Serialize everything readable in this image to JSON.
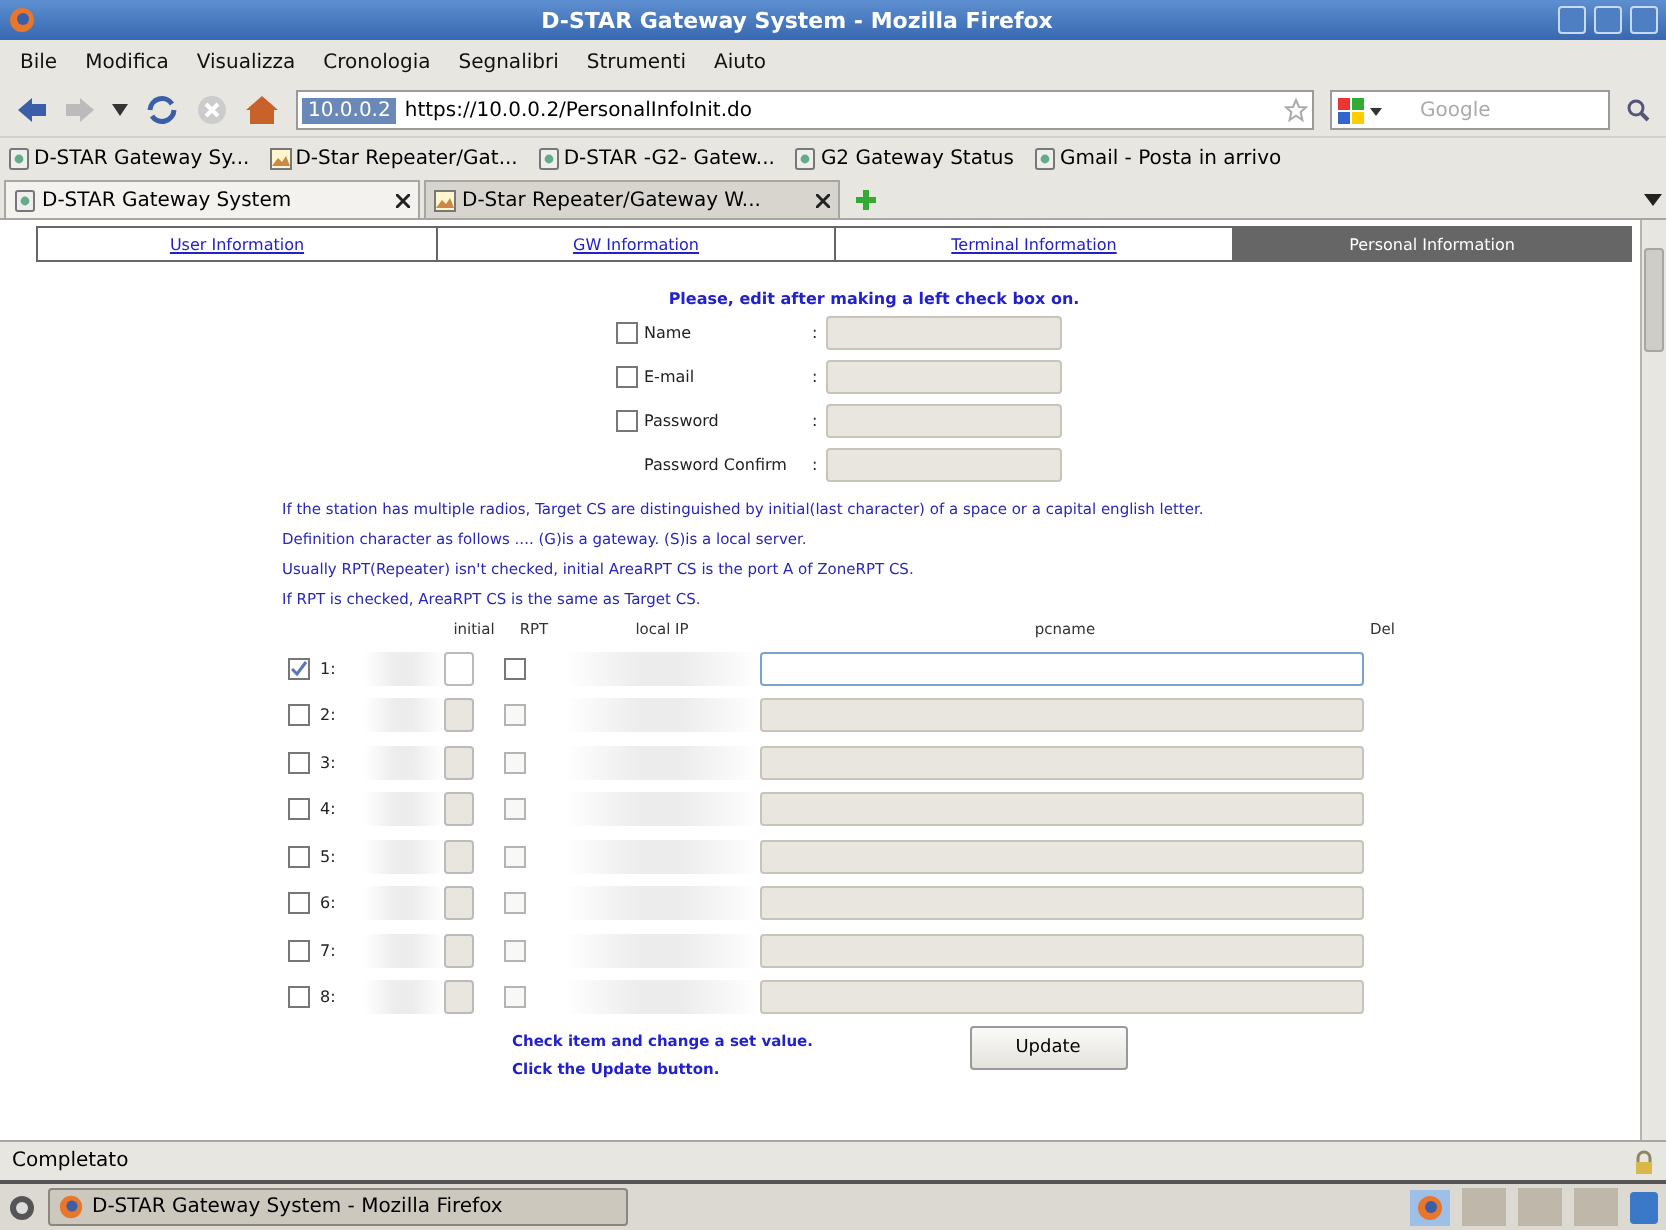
{
  "window": {
    "title": "D-STAR Gateway System - Mozilla Firefox"
  },
  "menu": [
    "Bile",
    "Modifica",
    "Visualizza",
    "Cronologia",
    "Segnalibri",
    "Strumenti",
    "Aiuto"
  ],
  "address_bar": {
    "site": "10.0.0.2",
    "url": "https://10.0.0.2/PersonalInfoInit.do"
  },
  "search": {
    "placeholder": "Google"
  },
  "bookmarks": [
    {
      "label": "D-STAR Gateway Sy...",
      "kind": "page"
    },
    {
      "label": "D-Star Repeater/Gat...",
      "kind": "image"
    },
    {
      "label": "D-STAR -G2- Gatew...",
      "kind": "page"
    },
    {
      "label": "G2 Gateway Status",
      "kind": "page"
    },
    {
      "label": "Gmail - Posta in arrivo",
      "kind": "page"
    }
  ],
  "tabs": [
    {
      "label": "D-STAR Gateway System",
      "selected": true,
      "kind": "page"
    },
    {
      "label": "D-Star Repeater/Gateway W...",
      "selected": false,
      "kind": "image"
    }
  ],
  "nav": [
    {
      "label": "User Information",
      "selected": false
    },
    {
      "label": "GW Information",
      "selected": false
    },
    {
      "label": "Terminal Information",
      "selected": false
    },
    {
      "label": "Personal Information",
      "selected": true
    }
  ],
  "form": {
    "heading": "Please, edit after making a left check box on.",
    "fields": [
      {
        "label": "Name",
        "separator": ":",
        "kind": "checkable",
        "checked": false
      },
      {
        "label": "E-mail",
        "separator": ":",
        "kind": "checkable",
        "checked": false
      },
      {
        "label": "Password",
        "separator": ":",
        "kind": "checkable",
        "checked": false
      },
      {
        "label": "Password Confirm",
        "separator": ":",
        "kind": "plain"
      }
    ]
  },
  "notes": [
    "If the station has multiple radios, Target CS are distinguished by initial(last character) of a space or a capital english letter.",
    "Definition character as follows .... (G)is a gateway. (S)is a local server.",
    "Usually RPT(Repeater) isn't checked, initial AreaRPT CS is the port A of ZoneRPT CS.",
    "If RPT is checked, AreaRPT CS is the same as Target CS."
  ],
  "table": {
    "columns": [
      "initial",
      "RPT",
      "local IP",
      "pcname",
      "Del"
    ],
    "rows": [
      {
        "number": "1:",
        "checked": true,
        "disabled": false
      },
      {
        "number": "2:",
        "checked": false,
        "disabled": true
      },
      {
        "number": "3:",
        "checked": false,
        "disabled": true
      },
      {
        "number": "4:",
        "checked": false,
        "disabled": true
      },
      {
        "number": "5:",
        "checked": false,
        "disabled": true
      },
      {
        "number": "6:",
        "checked": false,
        "disabled": true
      },
      {
        "number": "7:",
        "checked": false,
        "disabled": true
      },
      {
        "number": "8:",
        "checked": false,
        "disabled": true
      }
    ]
  },
  "footer_notes": [
    "Check item and change a set value.",
    "Click the Update button."
  ],
  "update_button": "Update",
  "status_bar": "Completato",
  "taskbar": {
    "task": "D-STAR Gateway System - Mozilla Firefox"
  }
}
